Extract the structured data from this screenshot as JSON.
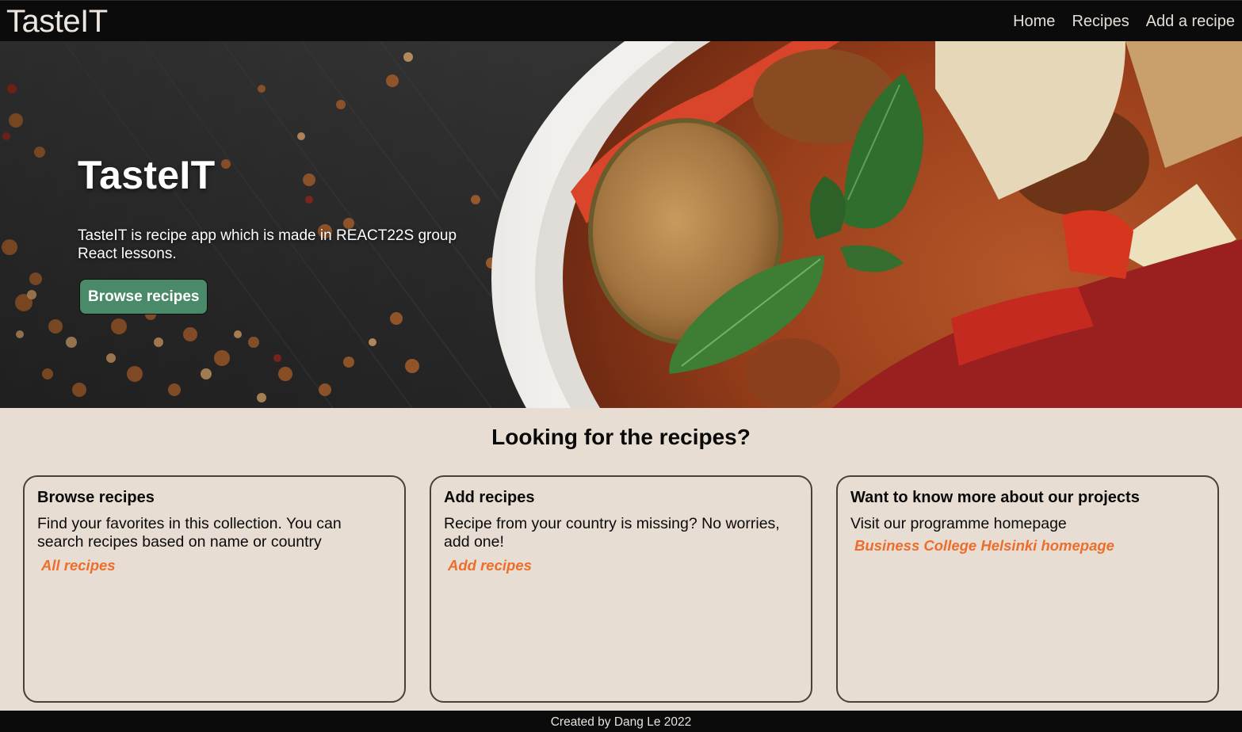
{
  "navbar": {
    "brand": "TasteIT",
    "links": [
      "Home",
      "Recipes",
      "Add a recipe"
    ]
  },
  "hero": {
    "title": "TasteIT",
    "description": "TasteIT is recipe app which is made in REACT22S group React lessons.",
    "button_label": "Browse recipes"
  },
  "section": {
    "title": "Looking for the recipes?",
    "cards": [
      {
        "title": "Browse recipes",
        "text": "Find your favorites in this collection. You can search recipes based on name or country",
        "link": "All recipes"
      },
      {
        "title": "Add recipes",
        "text": "Recipe from your country is missing? No worries, add one!",
        "link": "Add recipes"
      },
      {
        "title": "Want to know more about our projects",
        "text": "Visit our programme homepage",
        "link": "Business College Helsinki homepage"
      }
    ]
  },
  "footer": {
    "text": "Created by Dang Le 2022"
  },
  "colors": {
    "navbar_bg": "#0b0b0b",
    "page_bg": "#e8ddd2",
    "button_green": "#4b8a68",
    "link_orange": "#ec6e2c",
    "card_border": "#4a3f3a"
  }
}
